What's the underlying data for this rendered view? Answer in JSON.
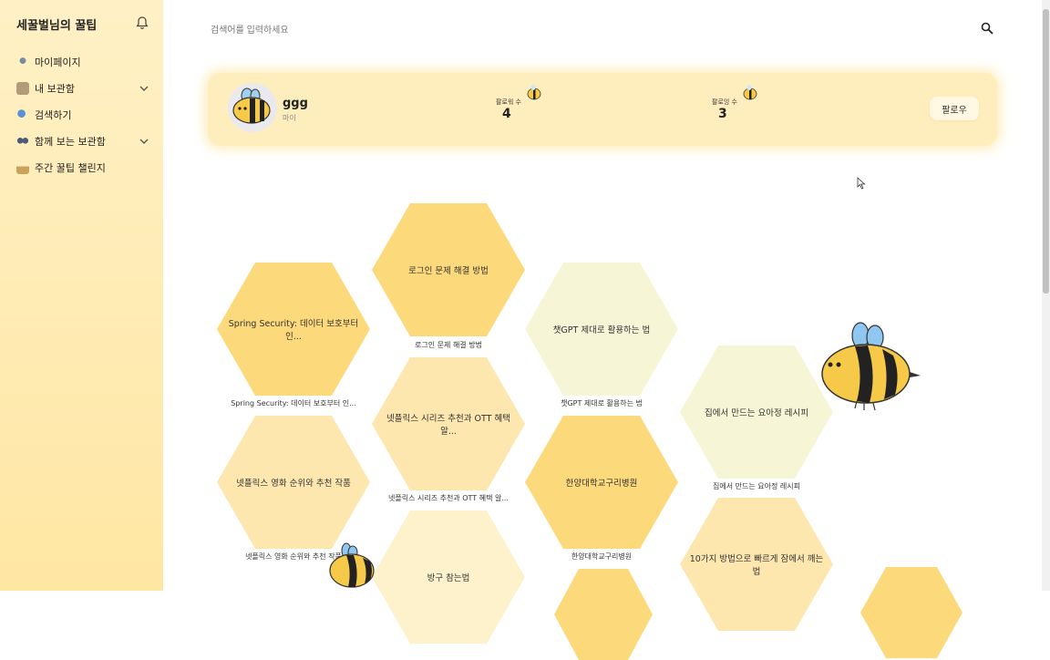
{
  "sidebar": {
    "title": "세꿀벌님의 꿀팁",
    "items": [
      {
        "label": "마이페이지",
        "icon": "mypage-icon"
      },
      {
        "label": "내 보관함",
        "icon": "archive-icon"
      },
      {
        "label": "검색하기",
        "icon": "search-nav-icon"
      },
      {
        "label": "함께 보는 보관함",
        "icon": "shared-icon"
      },
      {
        "label": "주간 꿀팁 챌린지",
        "icon": "challenge-icon"
      }
    ]
  },
  "search": {
    "placeholder": "검색어를 입력하세요"
  },
  "profile": {
    "name": "ggg",
    "sub": "마이",
    "follower_label": "팔로워 수",
    "follower_count": "4",
    "following_label": "팔로잉 수",
    "following_count": "3",
    "follow_button": "팔로우"
  },
  "cards": [
    {
      "title": "로그인 문제 해결 방법",
      "caption": "로그인 문제 해결 방법",
      "color": "#fcd97a"
    },
    {
      "title": "Spring Security: 데이터 보호부터 인...",
      "caption": "Spring Security: 데이터 보호부터 인...",
      "color": "#fcd97a"
    },
    {
      "title": "챗GPT 제대로 활용하는 법",
      "caption": "챗GPT 제대로 활용하는 법",
      "color": "#f6f6d6"
    },
    {
      "title": "넷플릭스 시리즈 추천과 OTT 혜택 알...",
      "caption": "넷플릭스 시리즈 추천과 OTT 혜택 알...",
      "color": "#fde7ae"
    },
    {
      "title": "집에서 만드는 요아정 레시피",
      "caption": "집에서 만드는 요아정 레시피",
      "color": "#f6f6d6"
    },
    {
      "title": "넷플릭스 영화 순위와 추천 작품",
      "caption": "넷플릭스 영화 순위와 추천 작품",
      "color": "#fde7ae"
    },
    {
      "title": "한양대학교구리병원",
      "caption": "한양대학교구리병원",
      "color": "#fcd97a"
    },
    {
      "title": "방구 참는법",
      "caption": "",
      "color": "#fdf2cc"
    },
    {
      "title": "10가지 방법으로 빠르게 잠에서 깨는 법",
      "caption": "",
      "color": "#fde7ae"
    }
  ],
  "colors": {
    "sidebar_top": "#fff1c6",
    "sidebar_bottom": "#ffe6a3",
    "profile_bg": "#ffeebd",
    "accent": "#fcd97a"
  }
}
